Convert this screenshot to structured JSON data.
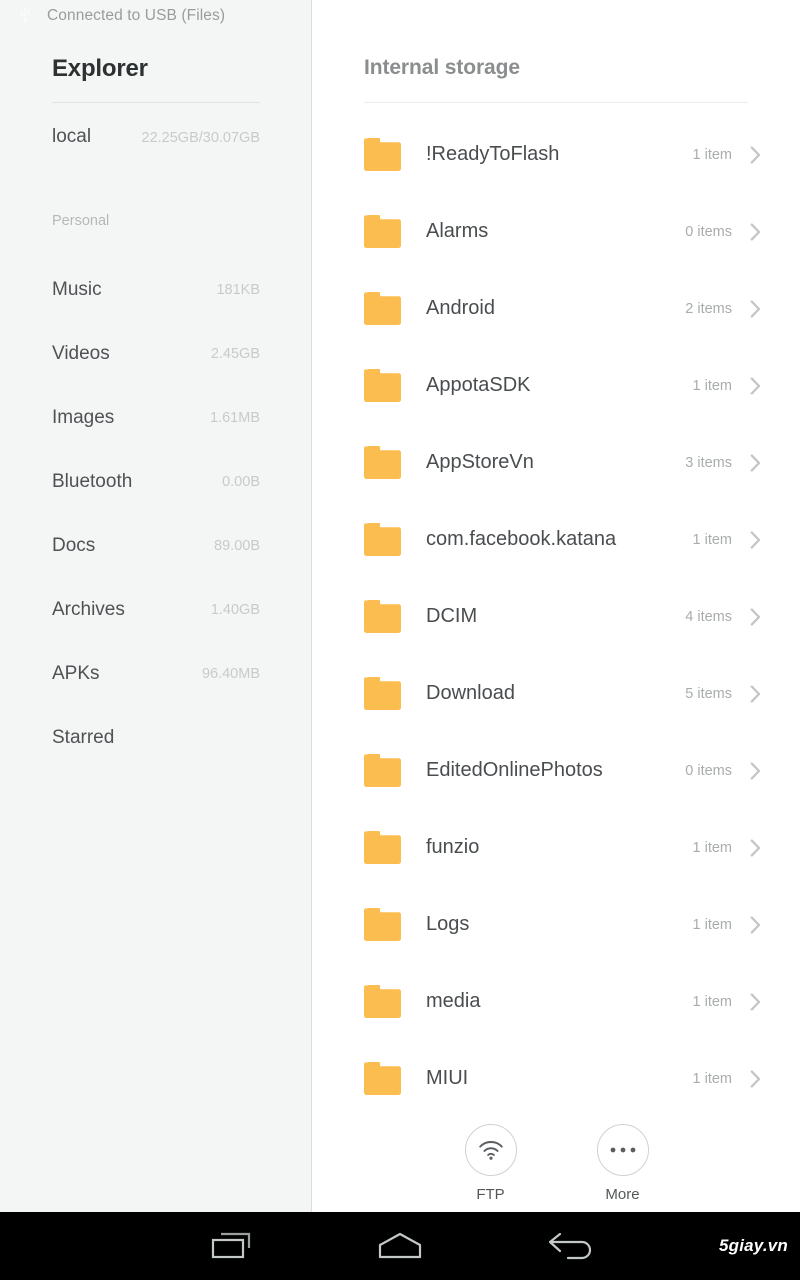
{
  "status_bar": {
    "icon": "usb-icon",
    "text": "Connected to USB (Files)"
  },
  "sidebar": {
    "title": "Explorer",
    "drive": {
      "name": "local",
      "usage": "22.25GB/30.07GB"
    },
    "section_label": "Personal",
    "items": [
      {
        "label": "Music",
        "size": "181KB"
      },
      {
        "label": "Videos",
        "size": "2.45GB"
      },
      {
        "label": "Images",
        "size": "1.61MB"
      },
      {
        "label": "Bluetooth",
        "size": "0.00B"
      },
      {
        "label": "Docs",
        "size": "89.00B"
      },
      {
        "label": "Archives",
        "size": "1.40GB"
      },
      {
        "label": "APKs",
        "size": "96.40MB"
      },
      {
        "label": "Starred",
        "size": ""
      }
    ]
  },
  "content": {
    "title": "Internal storage",
    "files": [
      {
        "name": "!ReadyToFlash",
        "count": "1 item",
        "icon": "folder-icon"
      },
      {
        "name": "Alarms",
        "count": "0 items",
        "icon": "folder-icon"
      },
      {
        "name": "Android",
        "count": "2 items",
        "icon": "folder-icon"
      },
      {
        "name": "AppotaSDK",
        "count": "1 item",
        "icon": "folder-icon"
      },
      {
        "name": "AppStoreVn",
        "count": "3 items",
        "icon": "folder-icon"
      },
      {
        "name": "com.facebook.katana",
        "count": "1 item",
        "icon": "folder-icon"
      },
      {
        "name": "DCIM",
        "count": "4 items",
        "icon": "folder-icon"
      },
      {
        "name": "Download",
        "count": "5 items",
        "icon": "folder-icon"
      },
      {
        "name": "EditedOnlinePhotos",
        "count": "0 items",
        "icon": "folder-icon"
      },
      {
        "name": "funzio",
        "count": "1 item",
        "icon": "folder-icon"
      },
      {
        "name": "Logs",
        "count": "1 item",
        "icon": "folder-icon"
      },
      {
        "name": "media",
        "count": "1 item",
        "icon": "folder-icon"
      },
      {
        "name": "MIUI",
        "count": "1 item",
        "icon": "folder-icon"
      }
    ]
  },
  "actions": [
    {
      "label": "FTP",
      "icon": "wifi-icon"
    },
    {
      "label": "More",
      "icon": "ellipsis-icon"
    }
  ],
  "navbar": {
    "recents": "recents-icon",
    "home": "home-icon",
    "back": "back-icon"
  },
  "watermark": "5giay.vn",
  "colors": {
    "folder": "#fbbd4f",
    "sidebar_bg": "#f4f5f5",
    "content_bg": "#ffffff",
    "navbar_bg": "#000000",
    "primary_text": "#4a4d4f",
    "muted_text": "#a9acac"
  }
}
